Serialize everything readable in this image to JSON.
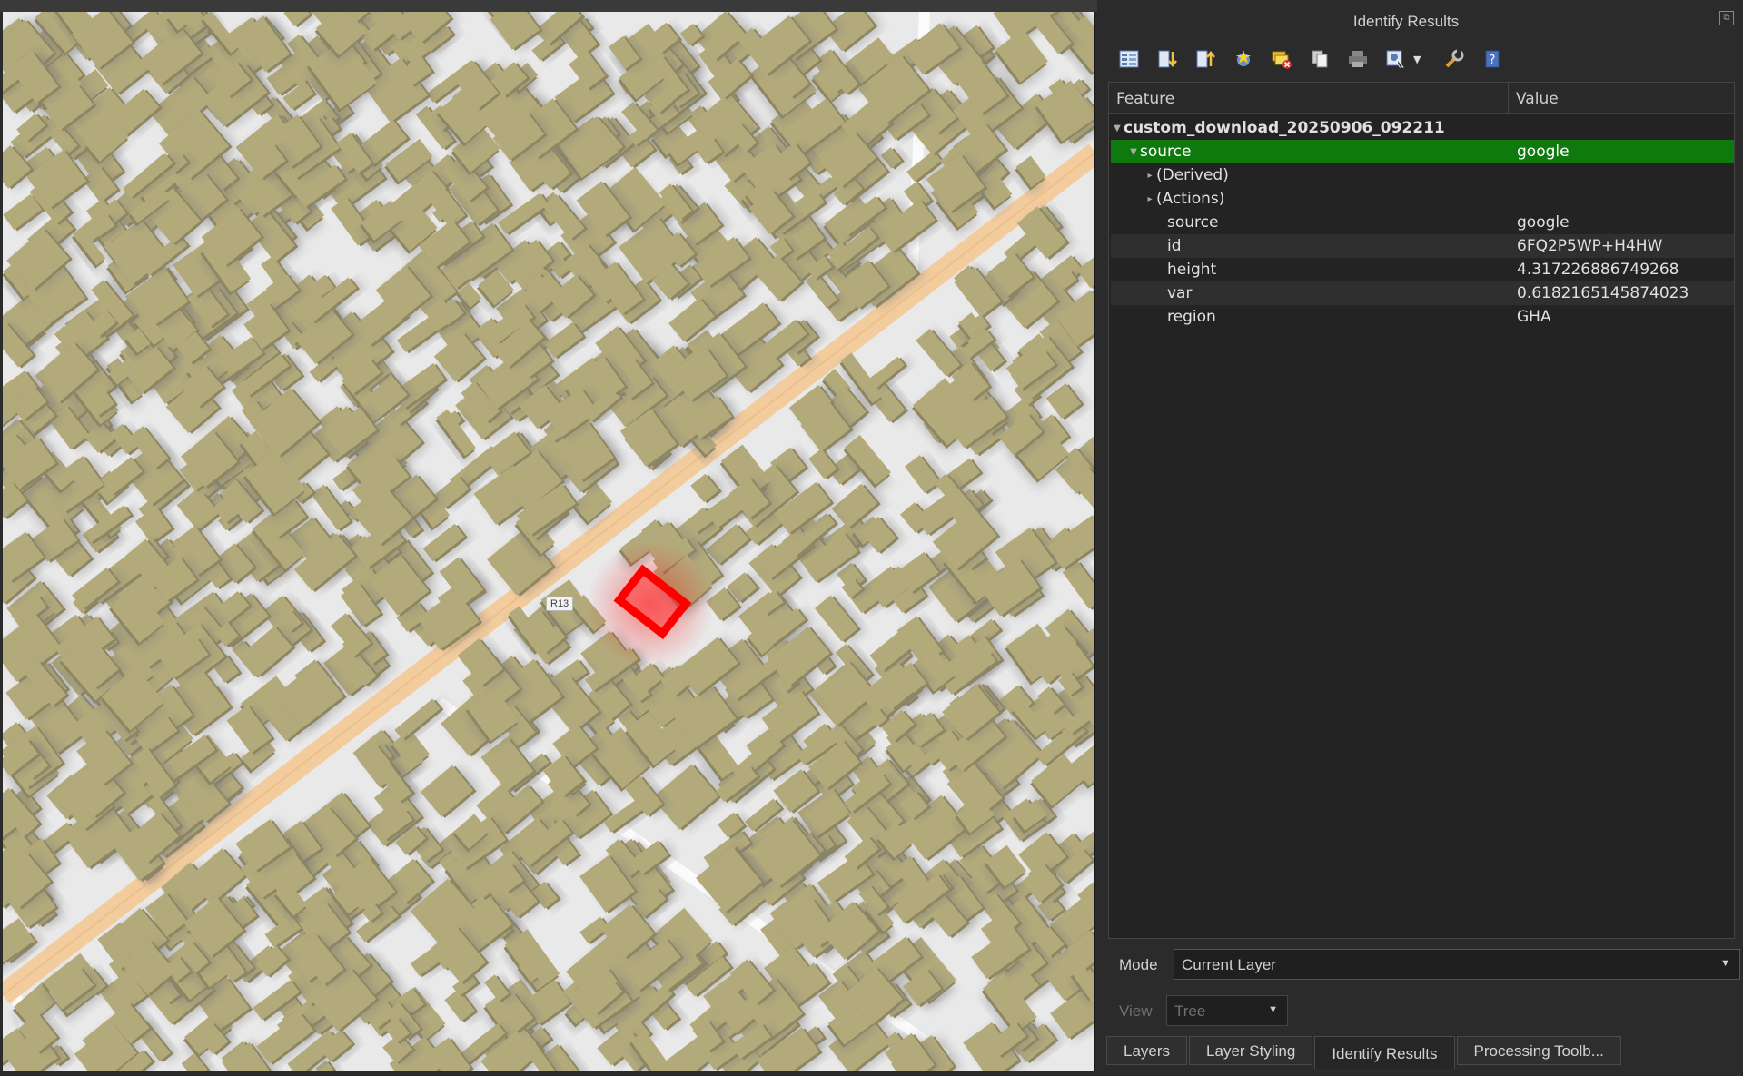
{
  "window": {
    "title": "Identify Results"
  },
  "map": {
    "road_label": "R13"
  },
  "toolbar": {
    "icons": [
      "expand-tree-icon",
      "expand-all-icon",
      "collapse-all-icon",
      "highlight-features-icon",
      "clear-results-icon",
      "copy-feature-icon",
      "print-icon",
      "select-features-icon",
      "identify-settings-icon",
      "help-icon"
    ]
  },
  "tree": {
    "header": {
      "feature": "Feature",
      "value": "Value"
    },
    "layer": "custom_download_20250906_092211",
    "rows": [
      {
        "feature": "source",
        "value": "google"
      },
      {
        "feature": "(Derived)",
        "value": ""
      },
      {
        "feature": "(Actions)",
        "value": ""
      },
      {
        "feature": "source",
        "value": "google"
      },
      {
        "feature": "id",
        "value": "6FQ2P5WP+H4HW"
      },
      {
        "feature": "height",
        "value": "4.317226886749268"
      },
      {
        "feature": "var",
        "value": "0.6182165145874023"
      },
      {
        "feature": "region",
        "value": "GHA"
      }
    ]
  },
  "mode": {
    "label": "Mode",
    "value": "Current Layer"
  },
  "view": {
    "label": "View",
    "value": "Tree"
  },
  "tabs": [
    "Layers",
    "Layer Styling",
    "Identify Results",
    "Processing Toolb..."
  ],
  "colors": {
    "selected_row": "#0e7a0e",
    "building": "#b3aa7b",
    "highlight": "#ff0000",
    "road": "#f0c896"
  }
}
